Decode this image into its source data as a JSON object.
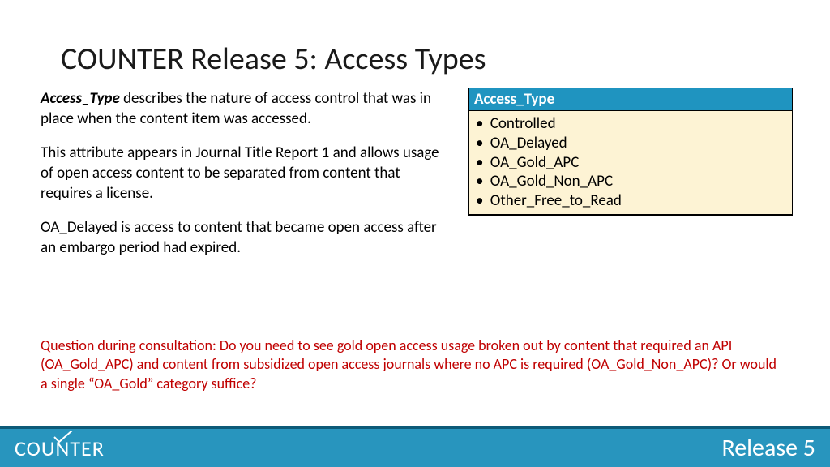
{
  "title": "COUNTER Release 5: Access Types",
  "body": {
    "lead_term": "Access_Type",
    "p1_rest": " describes the nature of access control that was in place when the content item was accessed.",
    "p2": "This attribute appears in Journal Title Report 1 and allows usage of open access content to be separated from content that requires a license.",
    "p3": "OA_Delayed is access to content that became open access after an embargo period had expired."
  },
  "table": {
    "header": "Access_Type",
    "items": [
      "Controlled",
      "OA_Delayed",
      "OA_Gold_APC",
      "OA_Gold_Non_APC",
      "Other_Free_to_Read"
    ]
  },
  "question": "Question during consultation: Do you need to see gold open access usage broken out by content that required an API (OA_Gold_APC) and content from subsidized open access journals where no APC is required (OA_Gold_Non_APC)? Or would a single “OA_Gold” category suffice?",
  "footer": {
    "logo_pre": "COU",
    "logo_n": "N",
    "logo_post": "TER",
    "release": "Release 5"
  }
}
